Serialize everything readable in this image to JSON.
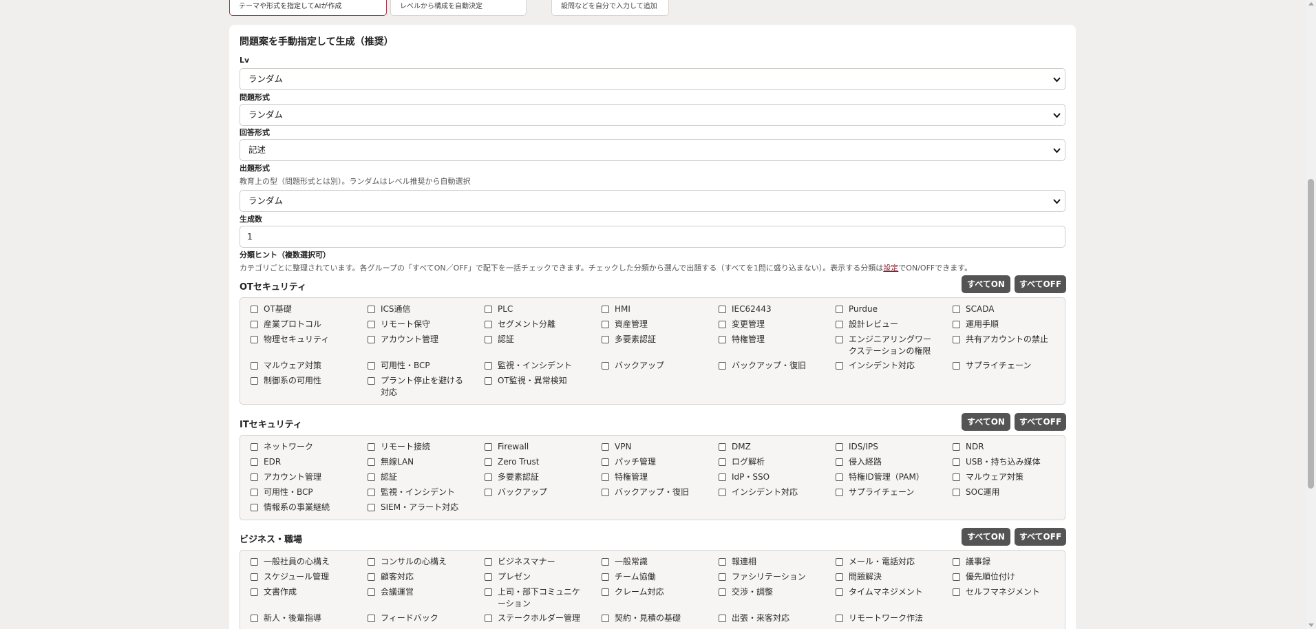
{
  "tabs": [
    {
      "label": "テーマや形式を指定してAIが作成",
      "active": true
    },
    {
      "label": "レベルから構成を自動決定",
      "active": false
    },
    {
      "label": "設問などを自分で入力して追加",
      "active": false
    }
  ],
  "card": {
    "title": "問題案を手動指定して生成（推奨）"
  },
  "fields": {
    "lv": {
      "label": "Lv",
      "value": "ランダム"
    },
    "question_type": {
      "label": "問題形式",
      "value": "ランダム"
    },
    "answer_type": {
      "label": "回答形式",
      "value": "記述"
    },
    "format": {
      "label": "出題形式",
      "help": "教育上の型（問題形式とは別）。ランダムはレベル推奨から自動選択",
      "value": "ランダム"
    },
    "count": {
      "label": "生成数",
      "value": "1"
    }
  },
  "hints": {
    "label": "分類ヒント（複数選択可）",
    "help_before": "カテゴリごとに整理されています。各グループの「すべてON／OFF」で配下を一括チェックできます。チェックした分類から選んで出題する（すべてを1問に盛り込まない）。表示する分類は",
    "help_link": "設定",
    "help_after": "でON/OFFできます。"
  },
  "buttons": {
    "all_on": "すべてON",
    "all_off": "すべてOFF"
  },
  "groups": [
    {
      "title": "OTセキュリティ",
      "rows": [
        [
          "OT基礎",
          "ICS通信",
          "PLC",
          "HMI",
          "IEC62443",
          "Purdue",
          "SCADA"
        ],
        [
          "産業プロトコル",
          "リモート保守",
          "セグメント分離",
          "資産管理",
          "変更管理",
          "設計レビュー",
          "運用手順"
        ],
        [
          "物理セキュリティ",
          "アカウント管理",
          "認証",
          "多要素認証",
          "特権管理",
          "エンジニアリングワークステーションの権限",
          "共有アカウントの禁止"
        ],
        [
          "マルウェア対策",
          "可用性・BCP",
          "監視・インシデント",
          "バックアップ",
          "バックアップ・復旧",
          "インシデント対応",
          "サプライチェーン"
        ],
        [
          "制御系の可用性",
          "プラント停止を避ける対応",
          "OT監視・異常検知"
        ]
      ]
    },
    {
      "title": "ITセキュリティ",
      "rows": [
        [
          "ネットワーク",
          "リモート接続",
          "Firewall",
          "VPN",
          "DMZ",
          "IDS/IPS",
          "NDR"
        ],
        [
          "EDR",
          "無線LAN",
          "Zero Trust",
          "パッチ管理",
          "ログ解析",
          "侵入経路",
          "USB・持ち込み媒体"
        ],
        [
          "アカウント管理",
          "認証",
          "多要素認証",
          "特権管理",
          "IdP・SSO",
          "特権ID管理（PAM）",
          "マルウェア対策"
        ],
        [
          "可用性・BCP",
          "監視・インシデント",
          "バックアップ",
          "バックアップ・復旧",
          "インシデント対応",
          "サプライチェーン",
          "SOC運用"
        ],
        [
          "情報系の事業継続",
          "SIEM・アラート対応"
        ]
      ]
    },
    {
      "title": "ビジネス・職場",
      "rows": [
        [
          "一般社員の心構え",
          "コンサルの心構え",
          "ビジネスマナー",
          "一般常識",
          "報連相",
          "メール・電話対応",
          "議事録"
        ],
        [
          "スケジュール管理",
          "顧客対応",
          "プレゼン",
          "チーム協働",
          "ファシリテーション",
          "問題解決",
          "優先順位付け"
        ],
        [
          "文書作成",
          "会議運営",
          "上司・部下コミュニケーション",
          "クレーム対応",
          "交渉・調整",
          "タイムマネジメント",
          "セルフマネジメント"
        ],
        [
          "新人・後輩指導",
          "フィードバック",
          "ステークホルダー管理",
          "契約・見積の基礎",
          "出張・来客対応",
          "リモートワーク作法"
        ]
      ]
    }
  ]
}
